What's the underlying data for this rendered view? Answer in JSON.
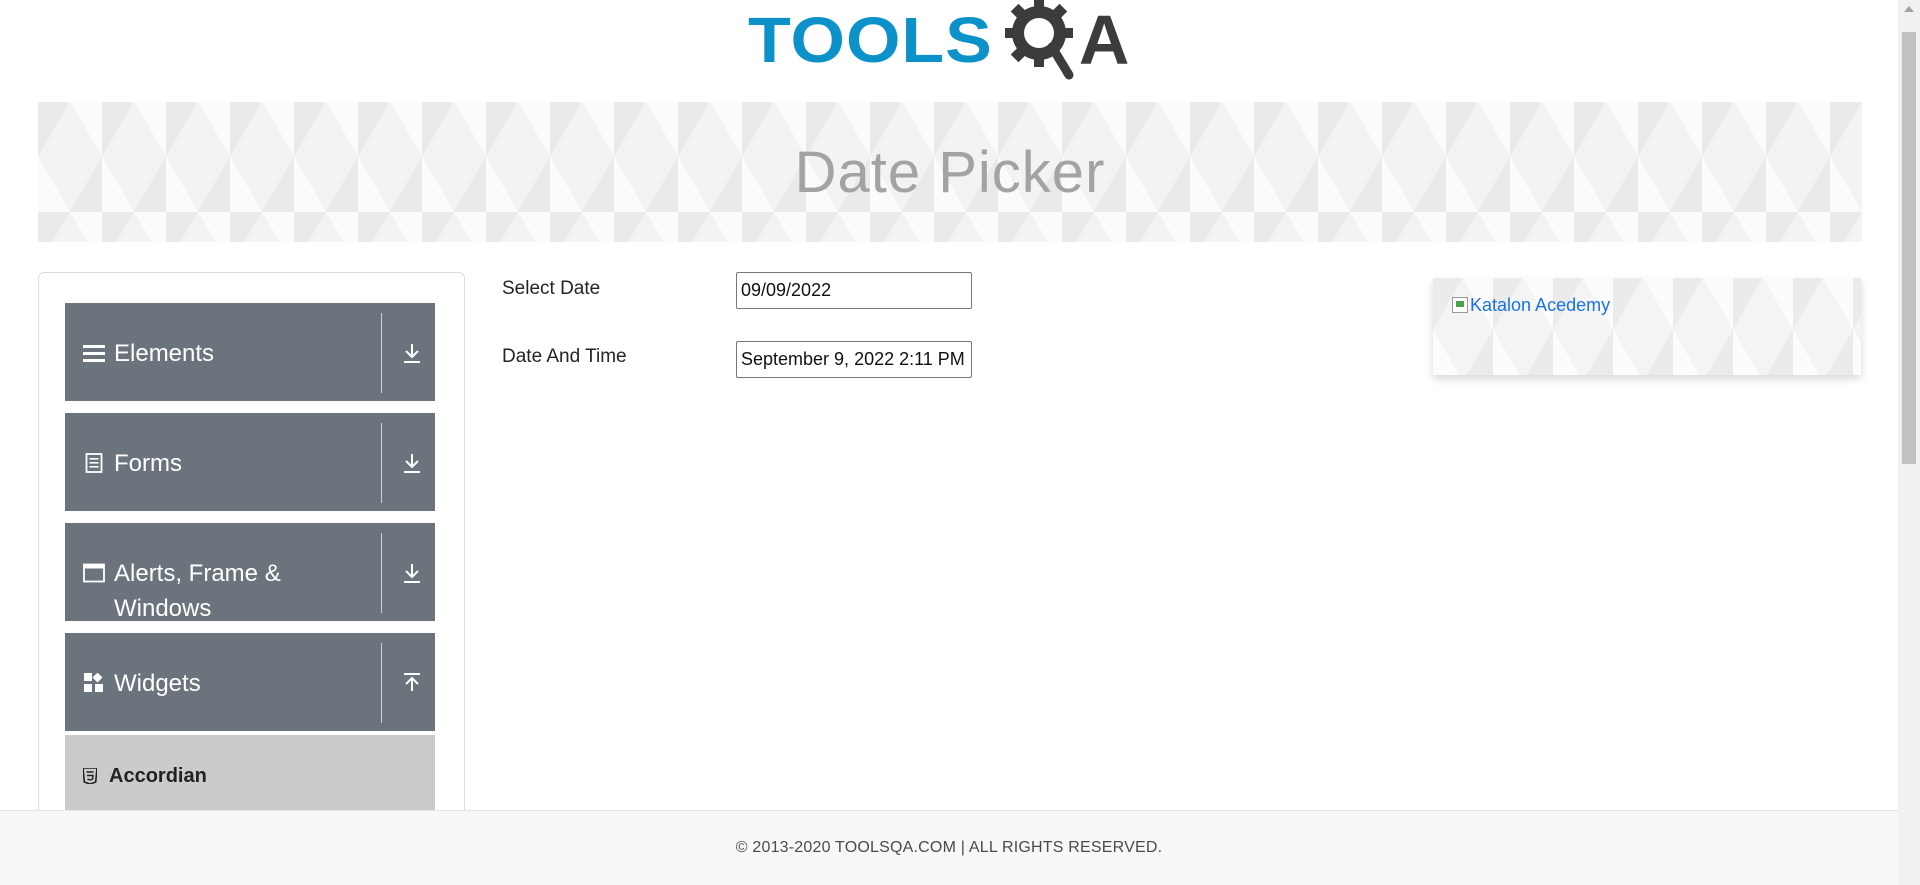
{
  "logo": {
    "brand_text": "TOOLS",
    "brand_suffix": "A",
    "colors": {
      "tools": "#0c92c9",
      "qa": "#3c3c3c"
    }
  },
  "banner": {
    "title": "Date Picker"
  },
  "sidebar": {
    "groups": [
      {
        "label": "Elements",
        "icon": "hamburger-icon",
        "arrow": "download-arrow-icon"
      },
      {
        "label": "Forms",
        "icon": "document-icon",
        "arrow": "download-arrow-icon"
      },
      {
        "label": "Alerts, Frame & Windows",
        "icon": "window-icon",
        "arrow": "download-arrow-icon"
      },
      {
        "label": "Widgets",
        "icon": "widgets-icon",
        "arrow": "upload-arrow-icon"
      }
    ],
    "sub_items": [
      {
        "label": "Accordian",
        "icon": "html5-icon"
      }
    ],
    "colors": {
      "group_bg": "#6b747c",
      "sub_item_bg": "#cbcbcb"
    }
  },
  "form": {
    "select_date": {
      "label": "Select Date",
      "value": "09/09/2022"
    },
    "date_and_time": {
      "label": "Date And Time",
      "value": "September 9, 2022 2:11 PM"
    }
  },
  "ad": {
    "alt_text": "Katalon Acedemy"
  },
  "footer": {
    "copyright": "© 2013-2020 TOOLSQA.COM | ALL RIGHTS RESERVED."
  }
}
